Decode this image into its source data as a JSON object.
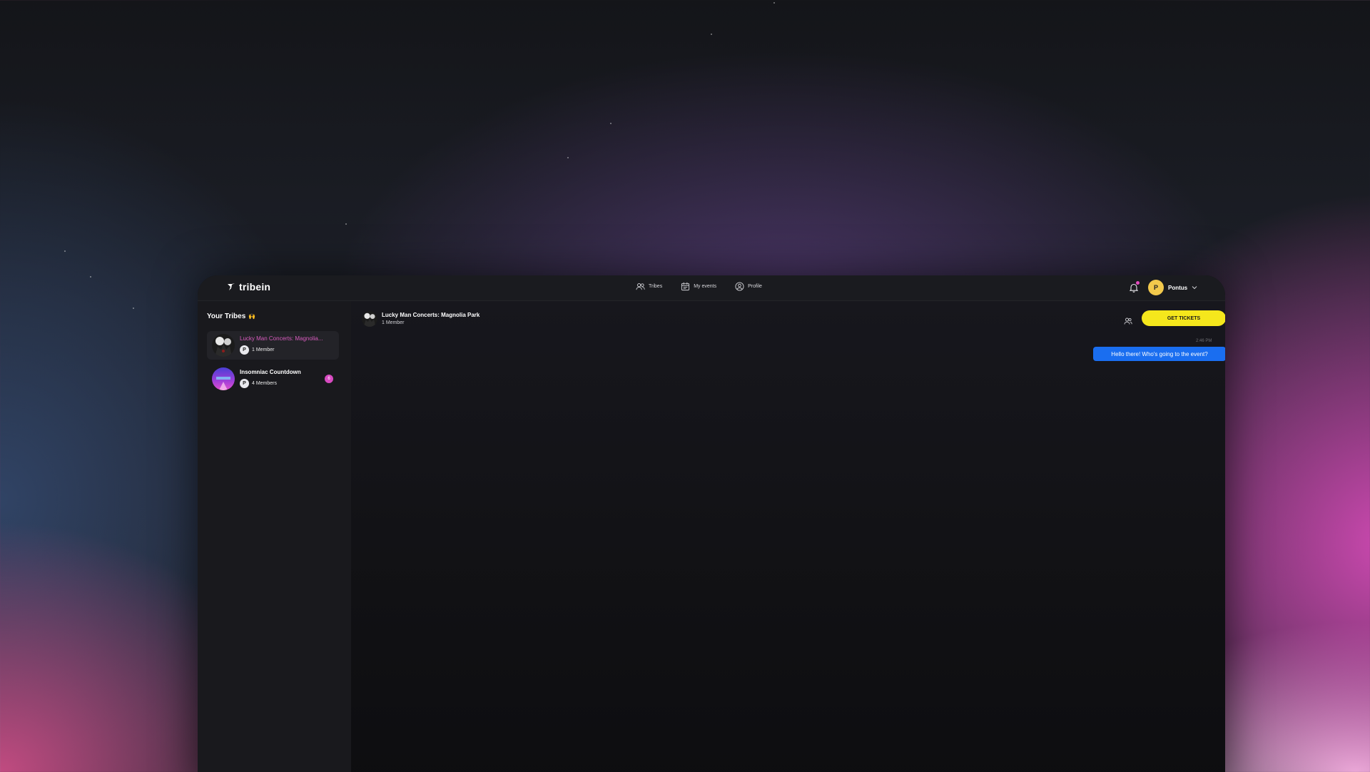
{
  "app": {
    "name": "tribein"
  },
  "nav": {
    "items": [
      {
        "label": "Tribes",
        "icon": "people-icon"
      },
      {
        "label": "My events",
        "icon": "calendar-icon"
      },
      {
        "label": "Profile",
        "icon": "user-circle-icon"
      }
    ]
  },
  "user": {
    "initial": "P",
    "name": "Pontus"
  },
  "sidebar": {
    "title": "Your Tribes",
    "title_emoji": "🙌",
    "tribes": [
      {
        "name": "Lucky Man Concerts: Magnolia...",
        "member_initial": "P",
        "count": "1 Member",
        "active": true
      },
      {
        "name": "Insomniac Countdown",
        "member_initial": "P",
        "count": "4 Members",
        "unread": "6",
        "active": false
      }
    ]
  },
  "chat": {
    "title": "Lucky Man Concerts: Magnolia Park",
    "subtitle": "1 Member",
    "cta": "GET TICKETS",
    "messages": [
      {
        "time": "2:46 PM",
        "text": "Hello there! Who's going to the event?"
      }
    ]
  },
  "colors": {
    "accent_pink": "#d75bbd",
    "cta_yellow": "#f5e71c",
    "bubble_blue": "#1a6ef0",
    "avatar_yellow": "#f2c94c"
  }
}
